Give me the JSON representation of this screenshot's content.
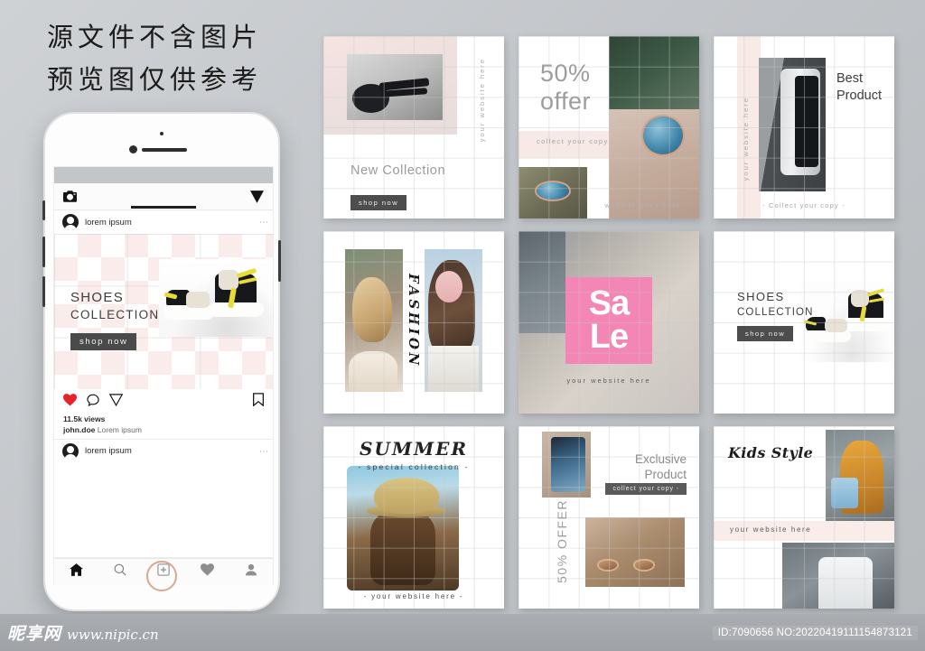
{
  "annotation": {
    "line1": "源文件不含图片",
    "line2": "预览图仅供参考"
  },
  "phone": {
    "app_header": {
      "camera_icon": "camera-icon",
      "send_icon": "paper-plane-icon"
    },
    "post": {
      "username": "lorem ipsum",
      "menu_icon": "more-options-icon",
      "title": "SHOES",
      "subtitle": "COLLECTION",
      "cta": "shop now",
      "actions": {
        "like_icon": "heart-icon",
        "comment_icon": "comment-bubble-icon",
        "share_icon": "paper-plane-icon",
        "save_icon": "bookmark-icon"
      },
      "views": "11.5k views",
      "caption_user": "john.doe",
      "caption_text": "Lorem ipsum"
    },
    "next_post": {
      "username": "lorem ipsum",
      "menu_icon": "more-options-icon"
    },
    "tab_bar": {
      "home_icon": "home-icon",
      "search_icon": "search-icon",
      "add_icon": "add-post-icon",
      "activity_icon": "heart-icon",
      "profile_icon": "profile-icon"
    },
    "home_button": "home-button"
  },
  "cards": [
    {
      "id": "new-collection",
      "title": "New Collection",
      "cta": "shop now",
      "vertical_text": "your website here"
    },
    {
      "id": "fifty-percent-offer",
      "headline_line1": "50%",
      "headline_line2": "offer",
      "collect": "collect your copy",
      "website": "website goes here"
    },
    {
      "id": "best-product",
      "title_line1": "Best",
      "title_line2": "Product",
      "vertical_text": "your website here",
      "collect": "- Collect your copy -"
    },
    {
      "id": "fashion",
      "vertical_title": "FASHION"
    },
    {
      "id": "sale",
      "headline_line1": "Sa",
      "headline_line2": "Le",
      "website": "your website here",
      "accent_color": "#f386b5"
    },
    {
      "id": "shoes-collection",
      "title": "SHOES",
      "subtitle": "COLLECTION",
      "cta": "shop now"
    },
    {
      "id": "summer",
      "title": "SUMMER",
      "subtitle": "- special collection -",
      "website": "- your website here -"
    },
    {
      "id": "exclusive-product",
      "title_line1": "Exclusive",
      "title_line2": "Product",
      "cta": "collect your copy -",
      "vertical_text": "50% OFFER"
    },
    {
      "id": "kids-style",
      "title": "Kids Style",
      "website": "your website here"
    }
  ],
  "footer": {
    "logo": "昵享网",
    "url": "www.nipic.cn",
    "id_text": "ID:7090656 NO:20220419111154873121"
  }
}
